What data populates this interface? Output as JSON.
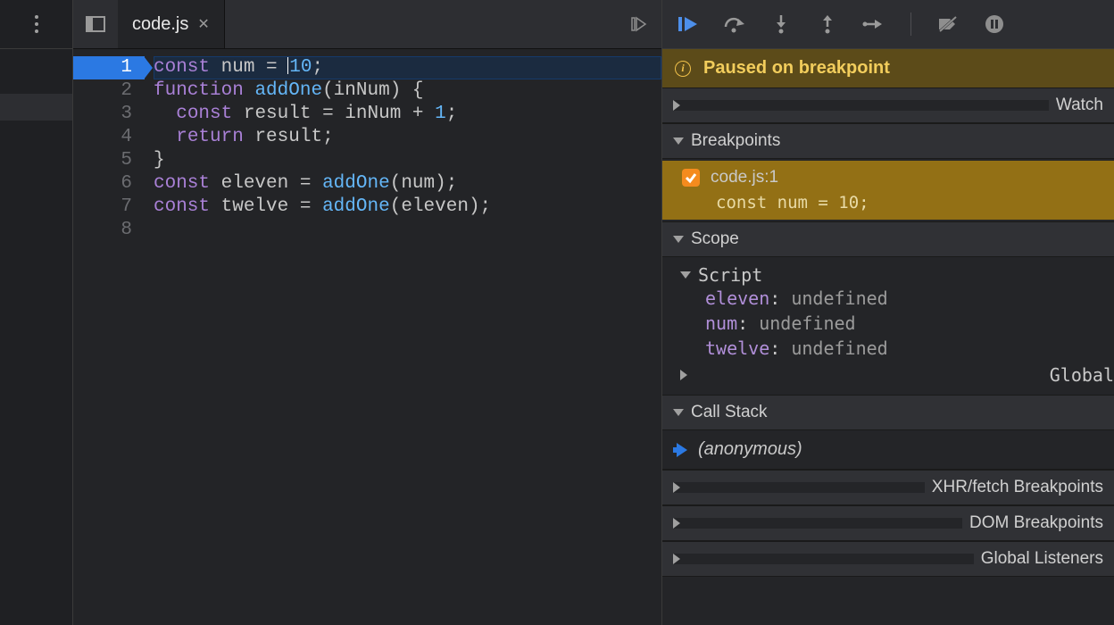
{
  "tab": {
    "filename": "code.js"
  },
  "code": {
    "execution_line": 1,
    "lines": [
      {
        "n": 1,
        "tokens": [
          [
            "kw",
            "const"
          ],
          [
            "sp",
            " "
          ],
          [
            "id",
            "num"
          ],
          [
            "sp",
            " "
          ],
          [
            "op",
            "="
          ],
          [
            "sp",
            " "
          ],
          [
            "cursor",
            ""
          ],
          [
            "num",
            "10"
          ],
          [
            "punc",
            ";"
          ]
        ]
      },
      {
        "n": 2,
        "tokens": [
          [
            "kw",
            "function"
          ],
          [
            "sp",
            " "
          ],
          [
            "fn",
            "addOne"
          ],
          [
            "punc",
            "("
          ],
          [
            "id",
            "inNum"
          ],
          [
            "punc",
            ")"
          ],
          [
            "sp",
            " "
          ],
          [
            "punc",
            "{"
          ]
        ]
      },
      {
        "n": 3,
        "tokens": [
          [
            "sp",
            "  "
          ],
          [
            "kw",
            "const"
          ],
          [
            "sp",
            " "
          ],
          [
            "id",
            "result"
          ],
          [
            "sp",
            " "
          ],
          [
            "op",
            "="
          ],
          [
            "sp",
            " "
          ],
          [
            "id",
            "inNum"
          ],
          [
            "sp",
            " "
          ],
          [
            "op",
            "+"
          ],
          [
            "sp",
            " "
          ],
          [
            "num",
            "1"
          ],
          [
            "punc",
            ";"
          ]
        ]
      },
      {
        "n": 4,
        "tokens": [
          [
            "sp",
            "  "
          ],
          [
            "kw",
            "return"
          ],
          [
            "sp",
            " "
          ],
          [
            "id",
            "result"
          ],
          [
            "punc",
            ";"
          ]
        ]
      },
      {
        "n": 5,
        "tokens": [
          [
            "punc",
            "}"
          ]
        ]
      },
      {
        "n": 6,
        "tokens": [
          [
            "kw",
            "const"
          ],
          [
            "sp",
            " "
          ],
          [
            "id",
            "eleven"
          ],
          [
            "sp",
            " "
          ],
          [
            "op",
            "="
          ],
          [
            "sp",
            " "
          ],
          [
            "fn",
            "addOne"
          ],
          [
            "punc",
            "("
          ],
          [
            "id",
            "num"
          ],
          [
            "punc",
            ")"
          ],
          [
            "punc",
            ";"
          ]
        ]
      },
      {
        "n": 7,
        "tokens": [
          [
            "kw",
            "const"
          ],
          [
            "sp",
            " "
          ],
          [
            "id",
            "twelve"
          ],
          [
            "sp",
            " "
          ],
          [
            "op",
            "="
          ],
          [
            "sp",
            " "
          ],
          [
            "fn",
            "addOne"
          ],
          [
            "punc",
            "("
          ],
          [
            "id",
            "eleven"
          ],
          [
            "punc",
            ")"
          ],
          [
            "punc",
            ";"
          ]
        ]
      },
      {
        "n": 8,
        "tokens": []
      }
    ]
  },
  "debugger": {
    "paused_message": "Paused on breakpoint",
    "sections": {
      "watch": "Watch",
      "breakpoints": "Breakpoints",
      "scope": "Scope",
      "callstack": "Call Stack",
      "xhr": "XHR/fetch Breakpoints",
      "dom": "DOM Breakpoints",
      "global_listeners": "Global Listeners"
    },
    "breakpoints": [
      {
        "label": "code.js:1",
        "code": "const num = 10;",
        "enabled": true
      }
    ],
    "scope": {
      "script_label": "Script",
      "global_label": "Global",
      "script_vars": [
        {
          "name": "eleven",
          "value": "undefined"
        },
        {
          "name": "num",
          "value": "undefined"
        },
        {
          "name": "twelve",
          "value": "undefined"
        }
      ]
    },
    "callstack": [
      {
        "name": "(anonymous)",
        "current": true
      }
    ]
  }
}
